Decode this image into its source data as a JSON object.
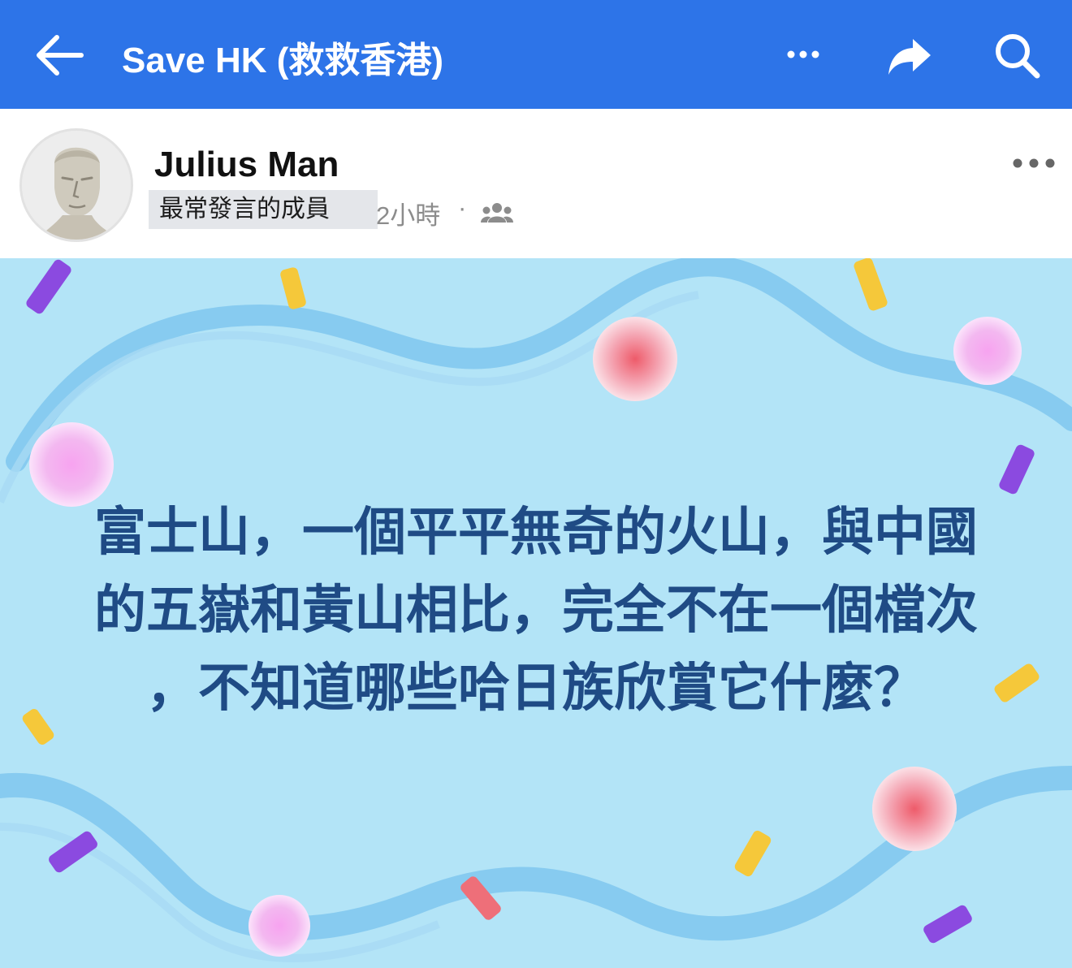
{
  "app_bar": {
    "title": "Save HK (救救香港)",
    "back_icon": "arrow-left-icon",
    "more_icon": "more-horizontal-icon",
    "share_icon": "share-arrow-icon",
    "search_icon": "search-icon",
    "background_color": "#2d74e8"
  },
  "post": {
    "author": "Julius Man",
    "badge": "最常發言的成員",
    "time": "2小時",
    "separator": "·",
    "audience_icon": "group-members-icon",
    "more_icon": "more-horizontal-icon",
    "image_text": [
      "富士山，一個平平無奇的火山，與中國",
      "的五嶽和黃山相比，完全不在一個檔次",
      "，不知道哪些哈日族欣賞它什麼？"
    ],
    "image_background_color": "#b3e4f7",
    "image_text_color": "#1f4b85"
  }
}
